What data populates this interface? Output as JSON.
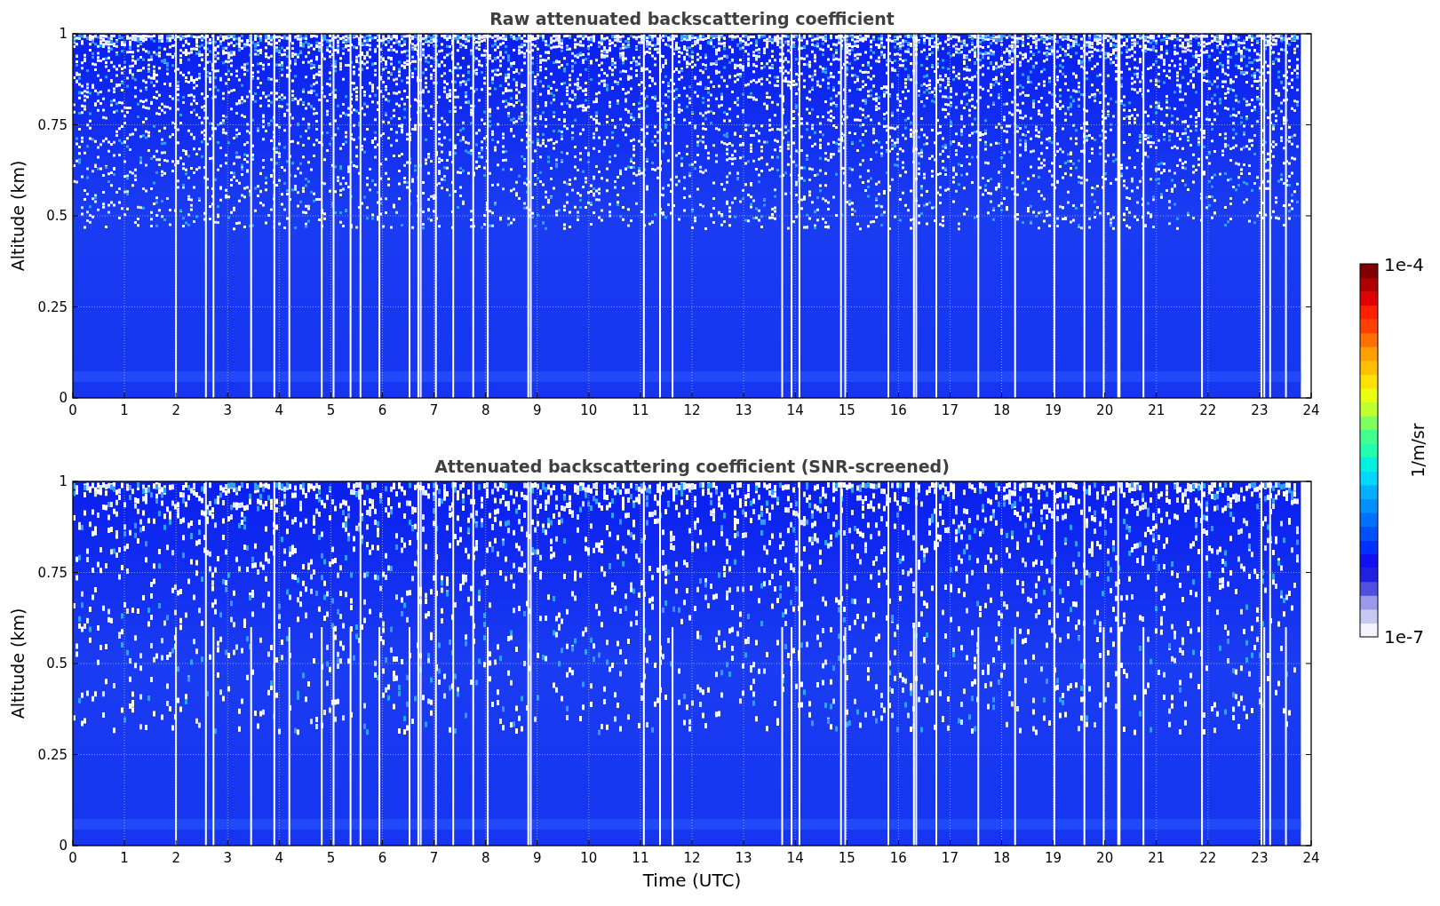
{
  "panels": [
    {
      "title": "Raw attenuated backscattering coefficient",
      "ylabel": "Altitude (km)",
      "yticks": [
        "1",
        "0.75",
        "0.5",
        "0.25",
        "0"
      ],
      "xticks": [
        "0",
        "1",
        "2",
        "3",
        "4",
        "5",
        "6",
        "7",
        "8",
        "9",
        "10",
        "11",
        "12",
        "13",
        "14",
        "15",
        "16",
        "17",
        "18",
        "19",
        "20",
        "21",
        "22",
        "23",
        "24"
      ]
    },
    {
      "title": "Attenuated backscattering coefficient (SNR-screened)",
      "ylabel": "Altitude (km)",
      "yticks": [
        "1",
        "0.75",
        "0.5",
        "0.25",
        "0"
      ],
      "xticks": [
        "0",
        "1",
        "2",
        "3",
        "4",
        "5",
        "6",
        "7",
        "8",
        "9",
        "10",
        "11",
        "12",
        "13",
        "14",
        "15",
        "16",
        "17",
        "18",
        "19",
        "20",
        "21",
        "22",
        "23",
        "24"
      ],
      "xlabel": "Time (UTC)"
    }
  ],
  "colorbar": {
    "top_label": "1e-4",
    "bottom_label": "1e-7",
    "unit": "1/m/sr"
  }
}
